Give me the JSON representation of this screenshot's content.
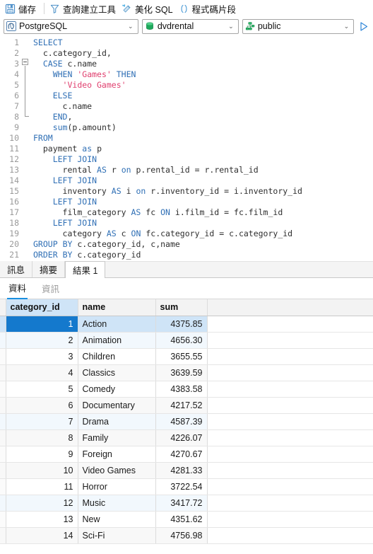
{
  "toolbar": {
    "items": [
      {
        "icon": "save-icon",
        "label": "儲存"
      },
      {
        "icon": "query-builder-icon",
        "label": "查詢建立工具"
      },
      {
        "icon": "beautify-icon",
        "label": "美化 SQL"
      },
      {
        "icon": "snippet-icon",
        "label": "程式碼片段"
      }
    ]
  },
  "connection": {
    "driver": {
      "icon": "postgresql-icon",
      "value": "PostgreSQL"
    },
    "database": {
      "icon": "database-icon",
      "value": "dvdrental"
    },
    "schema": {
      "icon": "schema-icon",
      "value": "public"
    },
    "run_button": {
      "icon": "run-triangle-icon",
      "title": ""
    },
    "arrow": "⌄"
  },
  "editor": {
    "line_numbers": [
      1,
      2,
      3,
      4,
      5,
      6,
      7,
      8,
      9,
      10,
      11,
      12,
      13,
      14,
      15,
      16,
      17,
      18,
      19,
      20,
      21
    ],
    "lines": [
      "SELECT",
      "  c.category_id,",
      "  CASE c.name",
      "    WHEN 'Games' THEN",
      "      'Video Games'",
      "    ELSE",
      "      c.name",
      "    END,",
      "    sum(p.amount)",
      "FROM",
      "  payment as p",
      "    LEFT JOIN",
      "      rental AS r on p.rental_id = r.rental_id",
      "    LEFT JOIN",
      "      inventory AS i on r.inventory_id = i.inventory_id",
      "    LEFT JOIN",
      "      film_category AS fc ON i.film_id = fc.film_id",
      "    LEFT JOIN",
      "      category AS c ON fc.category_id = c.category_id",
      "GROUP BY c.category_id, c,name",
      "ORDER BY c.category_id"
    ]
  },
  "result_tabs": [
    {
      "label": "訊息",
      "active": false
    },
    {
      "label": "摘要",
      "active": false
    },
    {
      "label": "結果 1",
      "active": true
    }
  ],
  "sub_tabs": [
    {
      "label": "資料",
      "active": true
    },
    {
      "label": "資訊",
      "active": false
    }
  ],
  "grid": {
    "columns": [
      "category_id",
      "name",
      "sum"
    ],
    "rows": [
      {
        "category_id": "1",
        "name": "Action",
        "sum": "4375.85"
      },
      {
        "category_id": "2",
        "name": "Animation",
        "sum": "4656.30"
      },
      {
        "category_id": "3",
        "name": "Children",
        "sum": "3655.55"
      },
      {
        "category_id": "4",
        "name": "Classics",
        "sum": "3639.59"
      },
      {
        "category_id": "5",
        "name": "Comedy",
        "sum": "4383.58"
      },
      {
        "category_id": "6",
        "name": "Documentary",
        "sum": "4217.52"
      },
      {
        "category_id": "7",
        "name": "Drama",
        "sum": "4587.39"
      },
      {
        "category_id": "8",
        "name": "Family",
        "sum": "4226.07"
      },
      {
        "category_id": "9",
        "name": "Foreign",
        "sum": "4270.67"
      },
      {
        "category_id": "10",
        "name": "Video Games",
        "sum": "4281.33"
      },
      {
        "category_id": "11",
        "name": "Horror",
        "sum": "3722.54"
      },
      {
        "category_id": "12",
        "name": "Music",
        "sum": "3417.72"
      },
      {
        "category_id": "13",
        "name": "New",
        "sum": "4351.62"
      },
      {
        "category_id": "14",
        "name": "Sci-Fi",
        "sum": "4756.98"
      }
    ],
    "selected_row_index": 0
  },
  "colors": {
    "accent": "#1479cd",
    "selection": "#cfe4f7",
    "keyword": "#2f6fb5",
    "string": "#e0406f",
    "green": "#19a463"
  }
}
